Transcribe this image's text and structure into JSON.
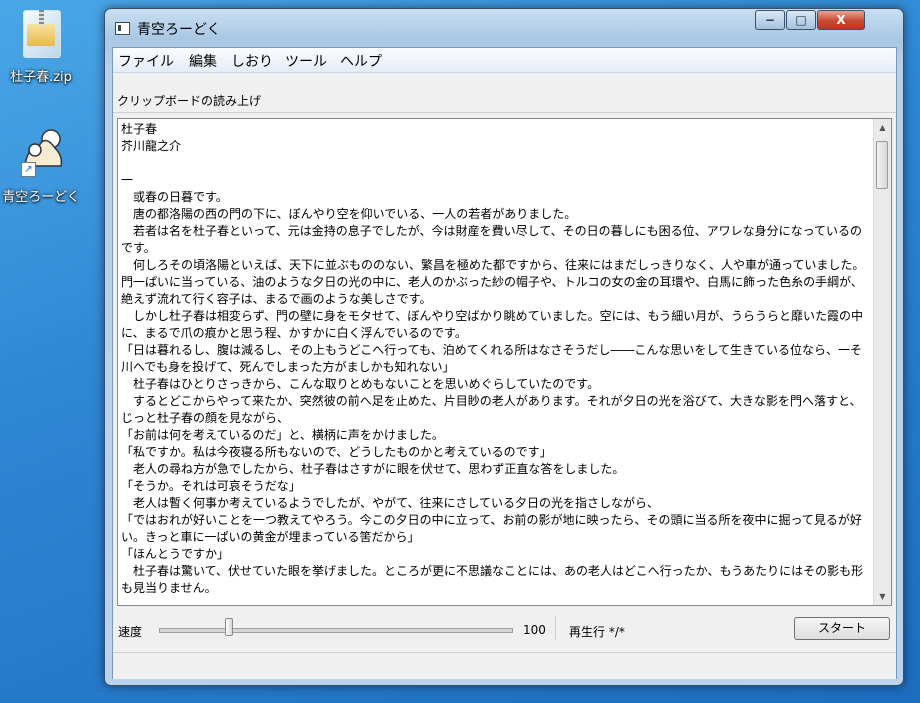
{
  "desktop": {
    "icons": [
      {
        "label": "杜子春.zip",
        "icon": "zip-archive-icon"
      },
      {
        "label": "青空ろーどく",
        "icon": "app-shortcut-icon"
      }
    ]
  },
  "window": {
    "title": "青空ろーどく",
    "controls": {
      "minimize": "−",
      "maximize": "□",
      "close": "X"
    },
    "menu": [
      "ファイル",
      "編集",
      "しおり",
      "ツール",
      "ヘルプ"
    ],
    "mode_label": "クリップボードの読み上げ",
    "text_body": "杜子春\n芥川龍之介\n\n一\n　或春の日暮です。\n　唐の都洛陽の西の門の下に、ぼんやり空を仰いでいる、一人の若者がありました。\n　若者は名を杜子春といって、元は金持の息子でしたが、今は財産を費い尽して、その日の暮しにも困る位、アワレな身分になっているのです。\n　何しろその頃洛陽といえば、天下に並ぶもののない、繁昌を極めた都ですから、往来にはまだしっきりなく、人や車が通っていました。門一ぱいに当っている、油のような夕日の光の中に、老人のかぶった紗の帽子や、トルコの女の金の耳環や、白馬に飾った色糸の手綱が、絶えず流れて行く容子は、まるで画のような美しさです。\n　しかし杜子春は相変らず、門の壁に身をモタせて、ぼんやり空ばかり眺めていました。空には、もう細い月が、うらうらと靡いた霞の中に、まるで爪の痕かと思う程、かすかに白く浮んでいるのです。\n「日は暮れるし、腹は減るし、その上もうどこへ行っても、泊めてくれる所はなさそうだし――こんな思いをして生きている位なら、一そ川へでも身を投げて、死んでしまった方がましかも知れない」\n　杜子春はひとりさっきから、こんな取りとめもないことを思いめぐらしていたのです。\n　するとどこからやって来たか、突然彼の前へ足を止めた、片目眇の老人があります。それが夕日の光を浴びて、大きな影を門へ落すと、じっと杜子春の顔を見ながら、\n「お前は何を考えているのだ」と、横柄に声をかけました。\n「私ですか。私は今夜寝る所もないので、どうしたものかと考えているのです」\n　老人の尋ね方が急でしたから、杜子春はさすがに眼を伏せて、思わず正直な答をしました。\n「そうか。それは可哀そうだな」\n　老人は暫く何事か考えているようでしたが、やがて、往来にさしている夕日の光を指さしながら、\n「ではおれが好いことを一つ教えてやろう。今この夕日の中に立って、お前の影が地に映ったら、その頭に当る所を夜中に掘って見るが好い。きっと車に一ぱいの黄金が埋まっている筈だから」\n「ほんとうですか」\n　杜子春は驚いて、伏せていた眼を挙げました。ところが更に不思議なことには、あの老人はどこへ行ったか、もうあたりにはその影も形も見当りません。",
    "scrollbar": {
      "up": "▲",
      "down": "▼"
    },
    "speed": {
      "label": "速度",
      "value": "100",
      "value_fraction": 0.2
    },
    "status_text": "再生行 */*",
    "start_button": "スタート"
  }
}
